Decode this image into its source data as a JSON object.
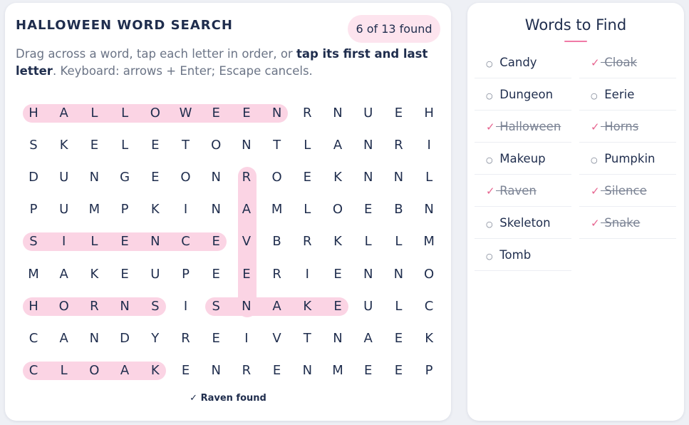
{
  "game": {
    "title": "HALLOWEEN WORD SEARCH",
    "progress": "6 of 13 found",
    "instructions": {
      "part1": "Drag across a word, tap each letter in order, or ",
      "bold": "tap its first and last letter",
      "part2": ". Keyboard: arrows + Enter; Escape cancels."
    },
    "status": "✓ Raven found"
  },
  "grid": [
    [
      "H",
      "A",
      "L",
      "L",
      "O",
      "W",
      "E",
      "E",
      "N",
      "R",
      "N",
      "U",
      "E",
      "H"
    ],
    [
      "S",
      "K",
      "E",
      "L",
      "E",
      "T",
      "O",
      "N",
      "T",
      "L",
      "A",
      "N",
      "R",
      "I"
    ],
    [
      "D",
      "U",
      "N",
      "G",
      "E",
      "O",
      "N",
      "R",
      "O",
      "E",
      "K",
      "N",
      "N",
      "L"
    ],
    [
      "P",
      "U",
      "M",
      "P",
      "K",
      "I",
      "N",
      "A",
      "M",
      "L",
      "O",
      "E",
      "B",
      "N"
    ],
    [
      "S",
      "I",
      "L",
      "E",
      "N",
      "C",
      "E",
      "V",
      "B",
      "R",
      "K",
      "L",
      "L",
      "M"
    ],
    [
      "M",
      "A",
      "K",
      "E",
      "U",
      "P",
      "E",
      "E",
      "R",
      "I",
      "E",
      "N",
      "N",
      "O"
    ],
    [
      "H",
      "O",
      "R",
      "N",
      "S",
      "I",
      "S",
      "N",
      "A",
      "K",
      "E",
      "U",
      "L",
      "C"
    ],
    [
      "C",
      "A",
      "N",
      "D",
      "Y",
      "R",
      "E",
      "I",
      "V",
      "T",
      "N",
      "A",
      "E",
      "K"
    ],
    [
      "C",
      "L",
      "O",
      "A",
      "K",
      "E",
      "N",
      "R",
      "E",
      "N",
      "M",
      "E",
      "E",
      "P"
    ]
  ],
  "highlights": [
    {
      "word": "Halloween",
      "from": [
        0,
        0
      ],
      "to": [
        0,
        8
      ]
    },
    {
      "word": "Silence",
      "from": [
        4,
        0
      ],
      "to": [
        4,
        6
      ]
    },
    {
      "word": "Horns",
      "from": [
        6,
        0
      ],
      "to": [
        6,
        4
      ]
    },
    {
      "word": "Snake",
      "from": [
        6,
        6
      ],
      "to": [
        6,
        10
      ]
    },
    {
      "word": "Cloak",
      "from": [
        8,
        0
      ],
      "to": [
        8,
        4
      ]
    },
    {
      "word": "Raven",
      "from": [
        2,
        7
      ],
      "to": [
        6,
        7
      ]
    }
  ],
  "words_panel": {
    "title": "Words to Find",
    "found_mark": "✓",
    "unfound_mark": "○",
    "words": [
      {
        "label": "Candy",
        "found": false
      },
      {
        "label": "Cloak",
        "found": true
      },
      {
        "label": "Dungeon",
        "found": false
      },
      {
        "label": "Eerie",
        "found": false
      },
      {
        "label": "Halloween",
        "found": true
      },
      {
        "label": "Horns",
        "found": true
      },
      {
        "label": "Makeup",
        "found": false
      },
      {
        "label": "Pumpkin",
        "found": false
      },
      {
        "label": "Raven",
        "found": true
      },
      {
        "label": "Silence",
        "found": true
      },
      {
        "label": "Skeleton",
        "found": false
      },
      {
        "label": "Snake",
        "found": true
      },
      {
        "label": "Tomb",
        "found": false
      }
    ]
  },
  "colors": {
    "highlight": "#fbd4e4",
    "accent": "#e6648f",
    "text": "#1f2d4d",
    "muted": "#6b7486"
  }
}
